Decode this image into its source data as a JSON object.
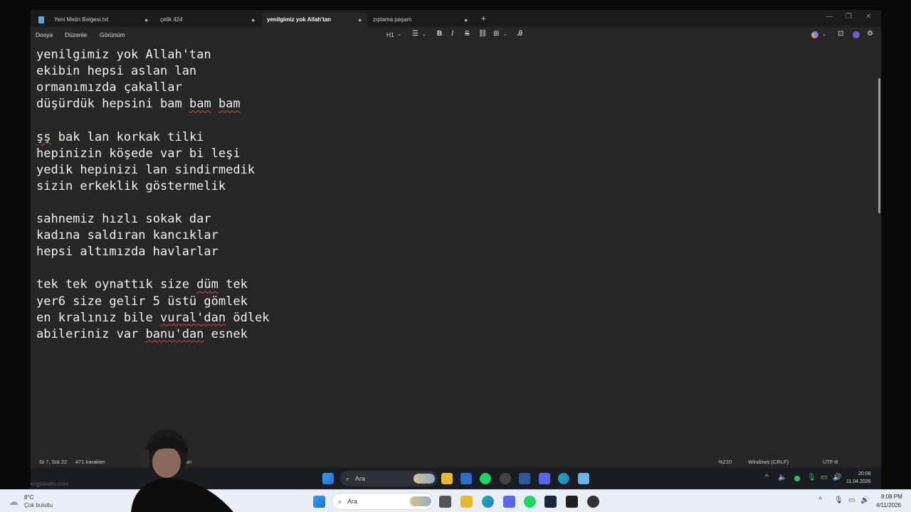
{
  "tabs": [
    {
      "label": "Yeni Metin Belgesi.txt"
    },
    {
      "label": "çelik 424"
    },
    {
      "label": "yenilgimiz yok Allah'tan"
    },
    {
      "label": "zıplama paşam"
    }
  ],
  "menu": {
    "file": "Dosya",
    "edit": "Düzenle",
    "view": "Görünüm"
  },
  "format": {
    "heading": "H1"
  },
  "lyrics": [
    "yenilgimiz yok Allah'tan",
    "ekibin hepsi aslan lan",
    "ormanımızda çakallar",
    "düşürdük hepsini bam bam bam",
    "",
    "şş bak lan korkak tilki",
    "hepinizin köşede var bi leşi",
    "yedik hepinizi lan sindirmedik",
    "sizin erkeklik göstermelik",
    "",
    "sahnemiz hızlı sokak dar",
    "kadına saldıran kancıklar",
    "hepsi altımızda havlarlar",
    "",
    "tek tek oynattık size düm tek",
    "yer6 size gelir 5 üstü gömlek",
    "en kralınız bile vural'dan ödlek",
    "abileriniz var banu'dan esnek"
  ],
  "status": {
    "position": "St 7, Süt 22",
    "chars": "471 karakter",
    "partial": "tin",
    "zoom": "%210",
    "line_ending": "Windows (CRLF)",
    "encoding": "UTF-8"
  },
  "inner_taskbar": {
    "search": "Ara",
    "time": "20:08",
    "date": "11.04.2026",
    "watermark": "knglstudio.com"
  },
  "outer_taskbar": {
    "search": "Ara",
    "temp": "8°C",
    "weather": "Çok bulutlu",
    "time": "8:08 PM",
    "date": "4/11/2026"
  },
  "colors": {
    "accent": "#5aa7d8",
    "editor_bg": "#272727",
    "spell_error": "#e04848"
  }
}
